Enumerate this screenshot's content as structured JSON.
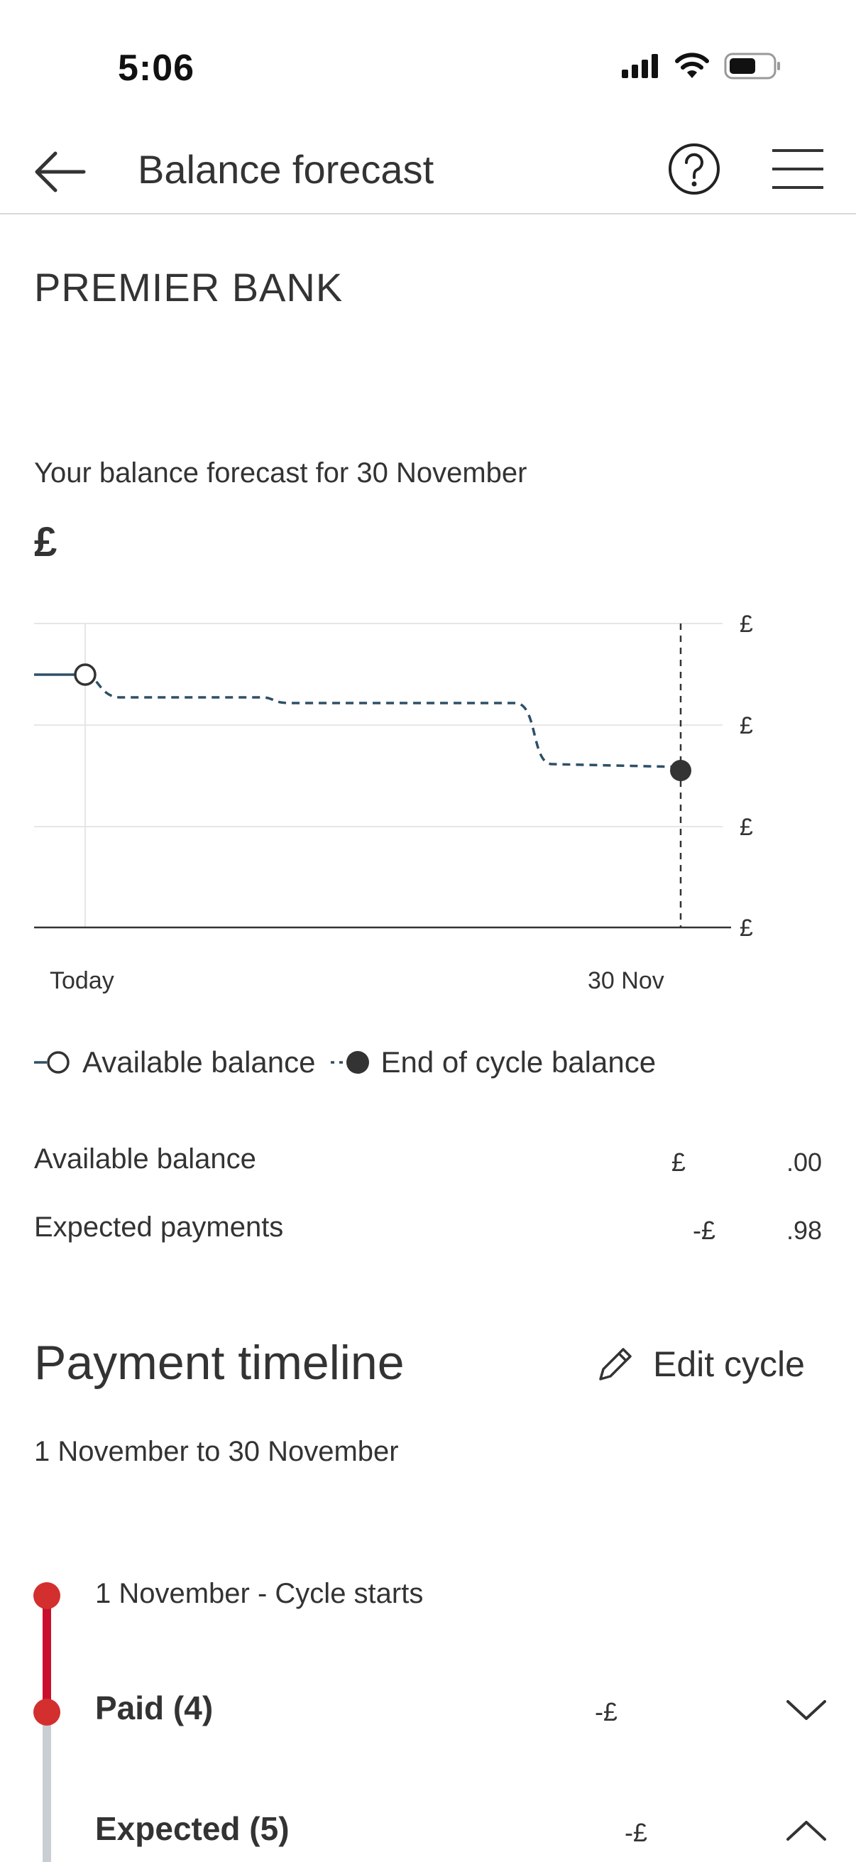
{
  "status_bar": {
    "time": "5:06"
  },
  "header": {
    "title": "Balance forecast"
  },
  "bank_name": "PREMIER BANK",
  "forecast": {
    "label": "Your balance forecast for 30 November",
    "amount": "£"
  },
  "chart_data": {
    "type": "line",
    "x_labels": [
      "Today",
      "30 Nov"
    ],
    "y_tick_labels": [
      "£",
      "£",
      "£",
      "£"
    ],
    "grid": true,
    "series": [
      {
        "name": "Available balance",
        "style": "solid",
        "marker": "open-circle"
      },
      {
        "name": "End of cycle balance",
        "style": "dashed",
        "marker": "filled-circle"
      }
    ],
    "relative_values": [
      0.84,
      0.76,
      0.74,
      0.74,
      0.53
    ],
    "colors": {
      "line": "#2e4f66",
      "end_marker": "#333333",
      "grid": "#e6e6e6",
      "axis": "#333333"
    }
  },
  "legend": {
    "available": "Available balance",
    "end_of_cycle": "End of cycle balance"
  },
  "summary": {
    "available_label": "Available balance",
    "available_currency": "£",
    "available_decimals": ".00",
    "expected_label": "Expected payments",
    "expected_currency": "-£",
    "expected_decimals": ".98"
  },
  "timeline": {
    "title": "Payment timeline",
    "edit_label": "Edit cycle",
    "range": "1 November to 30 November",
    "start_label": "1 November - Cycle starts",
    "paid_label": "Paid (4)",
    "paid_amount": "-£",
    "expected_label": "Expected (5)",
    "expected_amount": "-£",
    "colors": {
      "active": "#c8102e",
      "inactive": "#c9ced3"
    }
  }
}
